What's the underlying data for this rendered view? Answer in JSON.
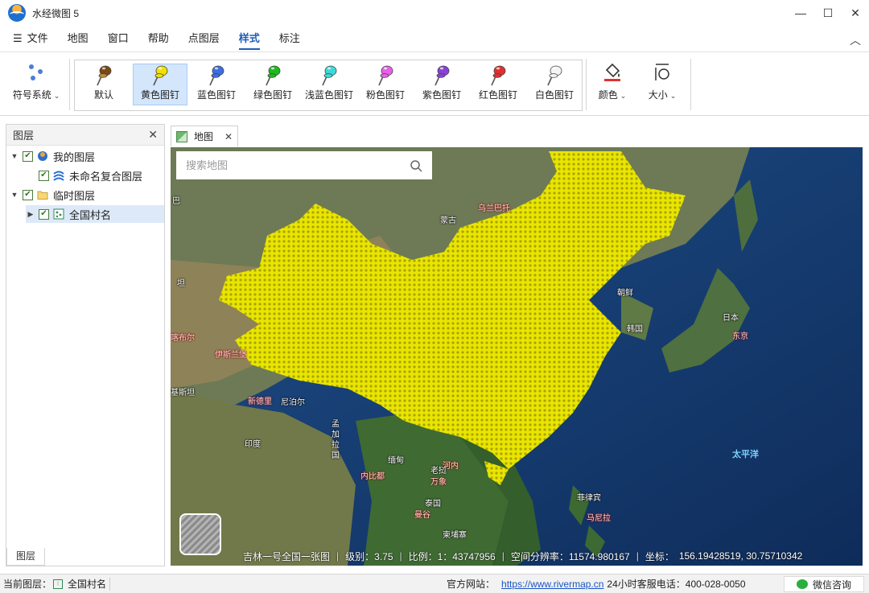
{
  "window": {
    "title": "水经微图 5"
  },
  "menu": {
    "items": [
      {
        "label": "文件",
        "name": "menu-file"
      },
      {
        "label": "地图",
        "name": "menu-map"
      },
      {
        "label": "窗口",
        "name": "menu-window"
      },
      {
        "label": "帮助",
        "name": "menu-help"
      },
      {
        "label": "点图层",
        "name": "menu-point-layer"
      },
      {
        "label": "样式",
        "name": "menu-style",
        "active": true
      },
      {
        "label": "标注",
        "name": "menu-annotation"
      }
    ]
  },
  "ribbon": {
    "symbol_system_label": "符号系统",
    "pins": [
      {
        "label": "默认",
        "color": "#c08a3a",
        "head": "#7a4a12"
      },
      {
        "label": "黄色图钉",
        "color": "#f2e000",
        "selected": true
      },
      {
        "label": "蓝色图钉",
        "color": "#3d6ee0"
      },
      {
        "label": "绿色图钉",
        "color": "#1fb81f"
      },
      {
        "label": "浅蓝色图钉",
        "color": "#3ed8d8"
      },
      {
        "label": "粉色图钉",
        "color": "#e860e8"
      },
      {
        "label": "紫色图钉",
        "color": "#8a40d8"
      },
      {
        "label": "红色图钉",
        "color": "#e03030"
      },
      {
        "label": "白色图钉",
        "color": "#f4f4f4"
      }
    ],
    "color_label": "颜色",
    "size_label": "大小"
  },
  "layers_panel": {
    "title": "图层",
    "tree": [
      {
        "label": "我的图层",
        "level": 0,
        "expanded": true,
        "checked": true,
        "icon": "globe-icon"
      },
      {
        "label": "未命名复合图层",
        "level": 1,
        "checked": true,
        "icon": "composite-layer-icon"
      },
      {
        "label": "临时图层",
        "level": 0,
        "expanded": true,
        "checked": true,
        "icon": "folder-icon"
      },
      {
        "label": "全国村名",
        "level": 1,
        "collapsed": true,
        "checked": true,
        "icon": "point-layer-icon",
        "selected": true
      }
    ],
    "footer_tab": "图层"
  },
  "map": {
    "tab_label": "地图",
    "search_placeholder": "搜索地图",
    "labels": {
      "mongolia": "蒙古",
      "ulaanbaatar": "乌兰巴托",
      "dprk": "朝鲜",
      "korea": "韩国",
      "japan": "日本",
      "tokyo": "东京",
      "pacific": "太平洋",
      "kathmandu": "尼泊尔",
      "newdelhi": "新德里",
      "islamabad": "伊斯兰堡",
      "india": "印度",
      "bangladesh": "孟加拉国",
      "myanmar": "缅甸",
      "naypyidaw": "内比都",
      "laos": "老挝",
      "hanoi": "河内",
      "vientiane": "万象",
      "thailand": "泰国",
      "bangkok": "曼谷",
      "cambodia": "柬埔寨",
      "philippines": "菲律宾",
      "manila": "马尼拉",
      "pakistan": "基斯坦",
      "left_edge_1": "坦",
      "left_edge_2": "巴",
      "left_edge_3": "喀布尔"
    },
    "status": {
      "source": "吉林一号全国一张图",
      "level": "级别：3.75",
      "scale": "比例：1：43747956",
      "resolution": "空间分辨率：11574.980167",
      "coord_label": "坐标：",
      "coords": "156.19428519,  30.75710342"
    }
  },
  "statusbar": {
    "current_layer_label": "当前图层：",
    "current_layer": "全国村名",
    "website_label": "官方网站：",
    "website": "https://www.rivermap.cn",
    "hotline": "24小时客服电话：400-028-0050",
    "wechat": "微信咨询"
  }
}
